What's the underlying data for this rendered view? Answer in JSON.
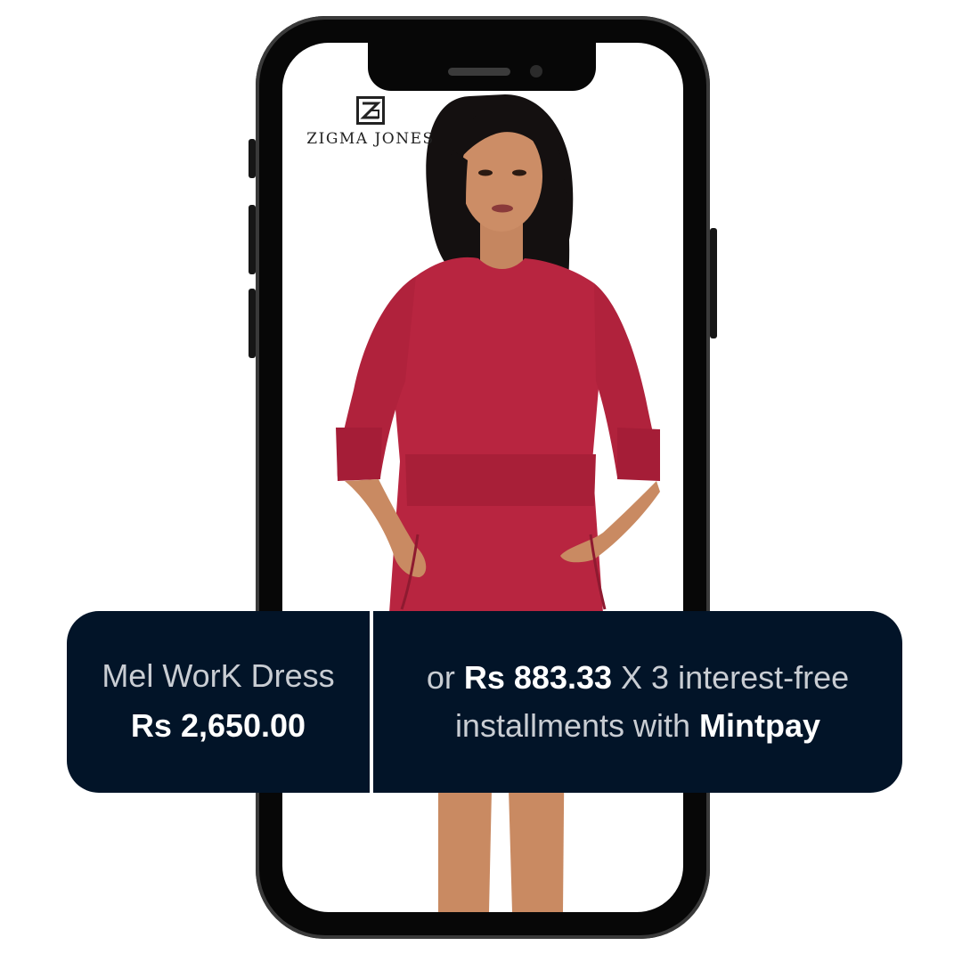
{
  "brand": {
    "name": "ZIGMA JONES"
  },
  "product": {
    "name": "Mel WorK Dress",
    "price": "Rs 2,650.00"
  },
  "offer": {
    "prefix": "or",
    "installment_amount": "Rs 883.33",
    "multiplier_text": "X 3 interest-free",
    "line2_prefix": "installments with",
    "provider": "Mintpay"
  },
  "colors": {
    "banner_background": "#021428",
    "dress": "#b82540",
    "phone_frame": "#070707"
  },
  "icons": {
    "brand_logo": "zigma-jones-logo-mark"
  }
}
